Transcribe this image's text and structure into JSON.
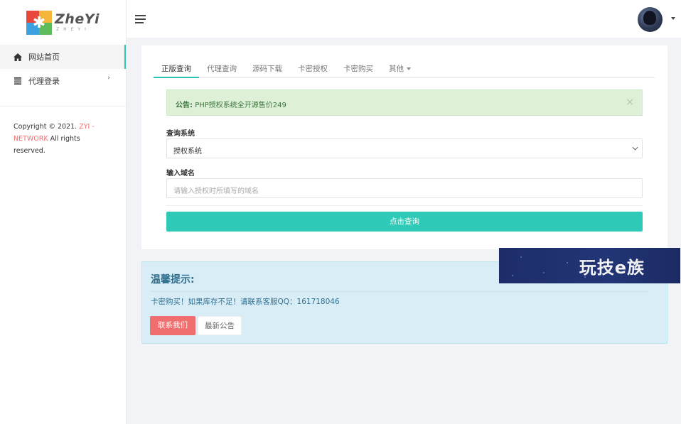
{
  "brand": {
    "name": "ZheYi",
    "subtitle": "ZHEYI"
  },
  "sidebar": {
    "items": [
      {
        "label": "网站首页",
        "icon": "home-icon",
        "active": true
      },
      {
        "label": "代理登录",
        "icon": "list-icon",
        "has_submenu": true
      }
    ],
    "copyright": {
      "prefix": "Copyright © 2021.",
      "brand": "ZYI - NETWORK",
      "suffix": "All rights reserved."
    }
  },
  "header": {
    "menu_icon": "hamburger-icon",
    "avatar_alt": "user-avatar"
  },
  "tabs": [
    {
      "label": "正版查询",
      "active": true
    },
    {
      "label": "代理查询"
    },
    {
      "label": "源码下载"
    },
    {
      "label": "卡密授权"
    },
    {
      "label": "卡密购买"
    },
    {
      "label": "其他",
      "dropdown": true
    }
  ],
  "alert": {
    "prefix": "公告:",
    "text": "PHP授权系统全开源售价249",
    "close": "×"
  },
  "form": {
    "system_label": "查询系统",
    "system_value": "授权系统",
    "domain_label": "输入域名",
    "domain_placeholder": "请输入授权时所填写的域名",
    "submit_label": "点击查询"
  },
  "tips": {
    "title": "温馨提示:",
    "text": "卡密购买！如果库存不足！请联系客服QQ：161718046",
    "contact_label": "联系我们",
    "news_label": "最新公告"
  },
  "watermark": {
    "text": "玩技e族"
  },
  "colors": {
    "accent": "#2ec9b7",
    "danger": "#f06e6e",
    "info_bg": "#d9edf7",
    "success_bg": "#dff0d8"
  }
}
